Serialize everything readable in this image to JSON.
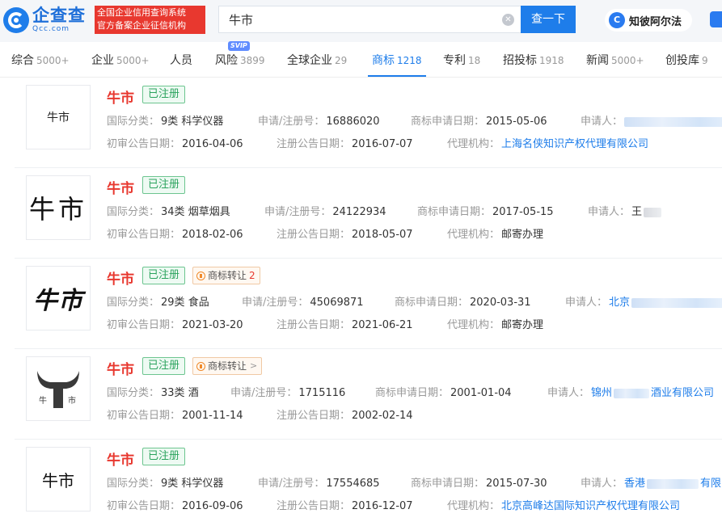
{
  "header": {
    "logo_cn": "企查查",
    "logo_en": "Qcc.com",
    "badge_line1": "全国企业信用查询系统",
    "badge_line2": "官方备案企业征信机构",
    "search_value": "牛市",
    "search_button": "查一下",
    "assistant_label": "知彼阿尔法",
    "assistant_icon": "C"
  },
  "tabs": [
    {
      "label": "综合",
      "count": "5000+"
    },
    {
      "label": "企业",
      "count": "5000+"
    },
    {
      "label": "人员",
      "count": ""
    },
    {
      "label": "风险",
      "count": "3899",
      "badge": "SVIP"
    },
    {
      "label": "全球企业",
      "count": "29"
    },
    {
      "label": "商标",
      "count": "1218",
      "active": true
    },
    {
      "label": "专利",
      "count": "18"
    },
    {
      "label": "招投标",
      "count": "1918"
    },
    {
      "label": "新闻",
      "count": "5000+"
    },
    {
      "label": "创投库",
      "count": "9"
    }
  ],
  "labels": {
    "class": "国际分类：",
    "reg_no": "申请/注册号：",
    "apply_date": "商标申请日期：",
    "applicant": "申请人：",
    "prelim_date": "初审公告日期：",
    "reg_date": "注册公告日期：",
    "agent": "代理机构：",
    "transfer": "商标转让"
  },
  "results": [
    {
      "name": "牛市",
      "thumb": "牛市",
      "status": "已注册",
      "class": "9类 科学仪器",
      "reg_no": "16886020",
      "apply_date": "2015-05-06",
      "applicant": "",
      "prelim_date": "2016-04-06",
      "reg_date": "2016-07-07",
      "agent": "上海名侠知识产权代理有限公司"
    },
    {
      "name": "牛市",
      "thumb": "牛市",
      "status": "已注册",
      "class": "34类 烟草烟具",
      "reg_no": "24122934",
      "apply_date": "2017-05-15",
      "applicant": "王",
      "prelim_date": "2018-02-06",
      "reg_date": "2018-05-07",
      "agent": "邮寄办理"
    },
    {
      "name": "牛市",
      "thumb": "牛市",
      "status": "已注册",
      "transfer_count": "2",
      "class": "29类 食品",
      "reg_no": "45069871",
      "apply_date": "2020-03-31",
      "applicant": "北京",
      "prelim_date": "2021-03-20",
      "reg_date": "2021-06-21",
      "agent": "邮寄办理"
    },
    {
      "name": "牛市",
      "thumb": "牛市",
      "status": "已注册",
      "class": "33类 酒",
      "reg_no": "1715116",
      "apply_date": "2001-01-04",
      "applicant": "锦州",
      "applicant_suffix": "酒业有限公司",
      "prelim_date": "2001-11-14",
      "reg_date": "2002-02-14",
      "agent": ""
    },
    {
      "name": "牛市",
      "thumb": "牛市",
      "status": "已注册",
      "class": "9类 科学仪器",
      "reg_no": "17554685",
      "apply_date": "2015-07-30",
      "applicant": "香港",
      "applicant_suffix": "有限",
      "prelim_date": "2016-09-06",
      "reg_date": "2016-12-07",
      "agent": "北京高峰达国际知识产权代理有限公司"
    }
  ]
}
